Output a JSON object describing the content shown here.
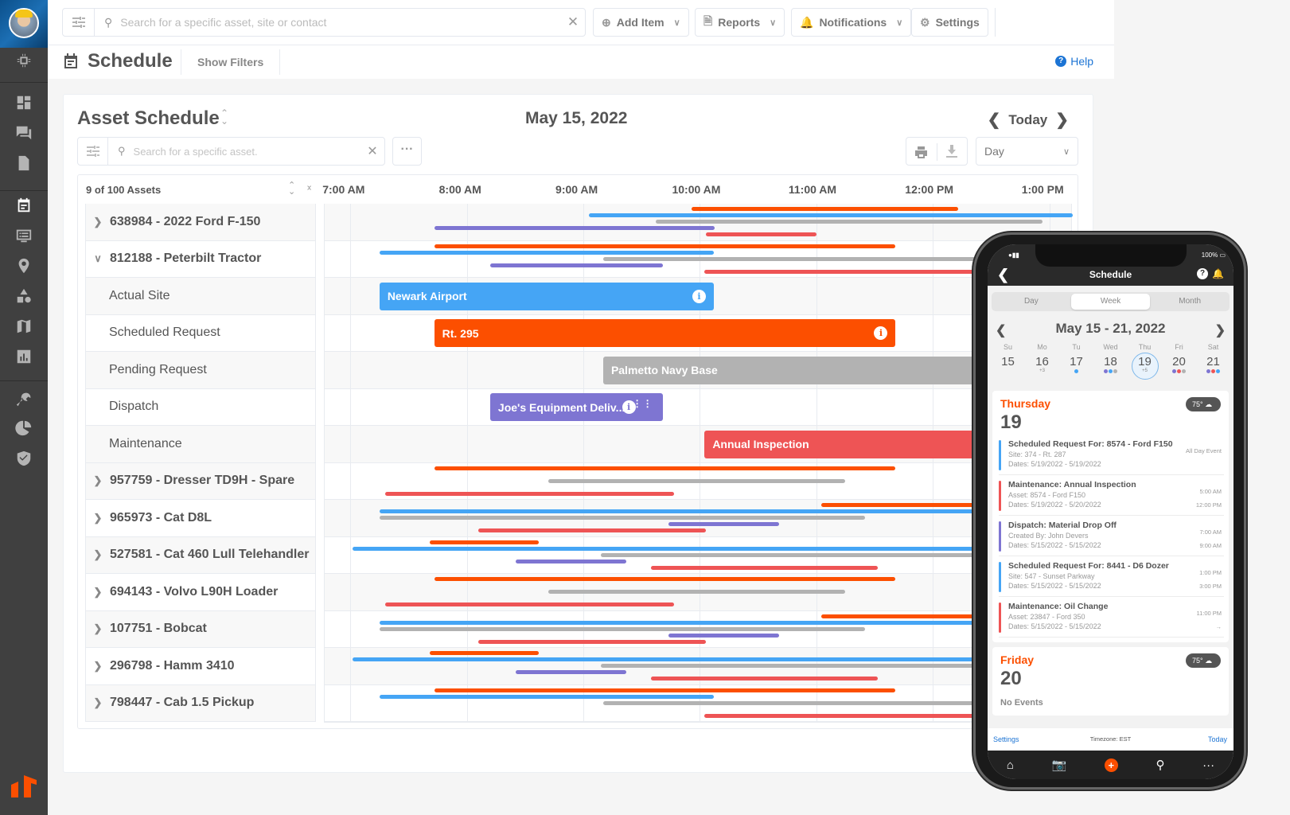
{
  "topbar": {
    "search_placeholder": "Search for a specific asset, site or contact",
    "buttons": [
      {
        "label": "Add Item",
        "icon": "plus-circle-icon"
      },
      {
        "label": "Reports",
        "icon": "document-icon"
      },
      {
        "label": "Notifications",
        "icon": "bell-icon"
      },
      {
        "label": "Settings",
        "icon": "gear-icon"
      }
    ]
  },
  "sidebar": {
    "items": [
      {
        "name": "chip-icon"
      },
      {
        "name": "dashboard-icon"
      },
      {
        "name": "messages-icon"
      },
      {
        "name": "document-icon"
      },
      {
        "name": "calendar-icon",
        "active": true
      },
      {
        "name": "list-monitor-icon"
      },
      {
        "name": "location-pin-icon"
      },
      {
        "name": "shapes-icon"
      },
      {
        "name": "map-icon"
      },
      {
        "name": "bar-chart-icon"
      },
      {
        "name": "wrench-icon"
      },
      {
        "name": "pie-chart-icon"
      },
      {
        "name": "shield-check-icon"
      }
    ],
    "brand_color": "#fc4f00"
  },
  "subbar": {
    "title": "Schedule",
    "show_filters": "Show Filters",
    "help": "Help"
  },
  "schedule": {
    "title": "Asset Schedule",
    "date": "May 15, 2022",
    "today": "Today",
    "search_placeholder": "Search for a specific asset.",
    "view": "Day",
    "asset_count": "9 of 100 Assets",
    "ticks": [
      "7:00 AM",
      "8:00 AM",
      "9:00 AM",
      "10:00 AM",
      "11:00 AM",
      "12:00 PM",
      "1:00 PM"
    ],
    "colors": {
      "site": "#45a5f5",
      "scheduled": "#fc4f00",
      "pending": "#b2b2b2",
      "dispatch": "#7e75d2",
      "maintenance": "#ee5455"
    },
    "rows": [
      {
        "label": "638984 - 2022 Ford F-150",
        "type": "parent",
        "expanded": false
      },
      {
        "label": "812188 - Peterbilt Tractor",
        "type": "parent",
        "expanded": true
      },
      {
        "label": "Actual Site",
        "type": "child"
      },
      {
        "label": "Scheduled Request",
        "type": "child"
      },
      {
        "label": "Pending Request",
        "type": "child"
      },
      {
        "label": "Dispatch",
        "type": "child"
      },
      {
        "label": "Maintenance",
        "type": "child"
      },
      {
        "label": "957759 - Dresser TD9H - Spare",
        "type": "parent",
        "expanded": false
      },
      {
        "label": "965973 - Cat D8L",
        "type": "parent",
        "expanded": false
      },
      {
        "label": "527581 - Cat 460 Lull Telehandler",
        "type": "parent",
        "expanded": false
      },
      {
        "label": "694143 - Volvo L90H Loader",
        "type": "parent",
        "expanded": false
      },
      {
        "label": "107751 - Bobcat",
        "type": "parent",
        "expanded": false
      },
      {
        "label": "296798 - Hamm 3410",
        "type": "parent",
        "expanded": false
      },
      {
        "label": "798447 - Cab 1.5 Pickup",
        "type": "parent",
        "expanded": false
      }
    ],
    "blocks": [
      {
        "row": 2,
        "label": "Newark Airport",
        "type": "site",
        "start": 7.25,
        "end": 10.12,
        "info": true
      },
      {
        "row": 3,
        "label": "Rt. 295",
        "type": "scheduled",
        "start": 7.72,
        "end": 11.68,
        "info": true
      },
      {
        "row": 4,
        "label": "Palmetto Navy Base",
        "type": "pending",
        "start": 9.17,
        "end": 13.0
      },
      {
        "row": 5,
        "label": "Joe's Equipment Deliv...",
        "type": "dispatch",
        "start": 8.2,
        "end": 9.68,
        "info": true,
        "drag": true
      },
      {
        "row": 6,
        "label": "Annual Inspection",
        "type": "maintenance",
        "start": 10.04,
        "end": 13.0
      }
    ],
    "lines": [
      {
        "row": 0,
        "slot": 0,
        "type": "scheduled",
        "start": 9.93,
        "end": 12.22
      },
      {
        "row": 0,
        "slot": 1,
        "type": "site",
        "start": 9.05,
        "end": 13.45
      },
      {
        "row": 0,
        "slot": 2,
        "type": "pending",
        "start": 9.62,
        "end": 12.94
      },
      {
        "row": 0,
        "slot": 3,
        "type": "dispatch",
        "start": 7.72,
        "end": 10.13
      },
      {
        "row": 0,
        "slot": 4,
        "type": "maintenance",
        "start": 10.05,
        "end": 11.0
      },
      {
        "row": 1,
        "slot": 0,
        "type": "scheduled",
        "start": 7.72,
        "end": 11.68
      },
      {
        "row": 1,
        "slot": 1,
        "type": "site",
        "start": 7.25,
        "end": 10.12
      },
      {
        "row": 1,
        "slot": 2,
        "type": "pending",
        "start": 9.17,
        "end": 13.0
      },
      {
        "row": 1,
        "slot": 3,
        "type": "dispatch",
        "start": 8.2,
        "end": 9.68
      },
      {
        "row": 1,
        "slot": 4,
        "type": "maintenance",
        "start": 10.04,
        "end": 13.0
      },
      {
        "row": 7,
        "slot": 0,
        "type": "scheduled",
        "start": 7.72,
        "end": 11.68
      },
      {
        "row": 7,
        "slot": 2,
        "type": "pending",
        "start": 8.7,
        "end": 11.25
      },
      {
        "row": 7,
        "slot": 4,
        "type": "maintenance",
        "start": 7.3,
        "end": 9.78
      },
      {
        "row": 8,
        "slot": 0,
        "type": "scheduled",
        "start": 11.04,
        "end": 13.0
      },
      {
        "row": 8,
        "slot": 1,
        "type": "site",
        "start": 7.25,
        "end": 13.0
      },
      {
        "row": 8,
        "slot": 2,
        "type": "pending",
        "start": 7.25,
        "end": 11.42
      },
      {
        "row": 8,
        "slot": 3,
        "type": "dispatch",
        "start": 9.73,
        "end": 10.68
      },
      {
        "row": 8,
        "slot": 4,
        "type": "maintenance",
        "start": 8.1,
        "end": 10.05
      },
      {
        "row": 9,
        "slot": 0,
        "type": "scheduled",
        "start": 7.68,
        "end": 8.62
      },
      {
        "row": 9,
        "slot": 1,
        "type": "site",
        "start": 7.02,
        "end": 13.0
      },
      {
        "row": 9,
        "slot": 2,
        "type": "pending",
        "start": 9.15,
        "end": 13.0
      },
      {
        "row": 9,
        "slot": 3,
        "type": "dispatch",
        "start": 8.42,
        "end": 9.37
      },
      {
        "row": 9,
        "slot": 4,
        "type": "maintenance",
        "start": 9.58,
        "end": 11.53
      },
      {
        "row": 10,
        "slot": 0,
        "type": "scheduled",
        "start": 7.72,
        "end": 11.68
      },
      {
        "row": 10,
        "slot": 2,
        "type": "pending",
        "start": 8.7,
        "end": 11.25
      },
      {
        "row": 10,
        "slot": 4,
        "type": "maintenance",
        "start": 7.3,
        "end": 9.78
      },
      {
        "row": 11,
        "slot": 0,
        "type": "scheduled",
        "start": 11.04,
        "end": 13.0
      },
      {
        "row": 11,
        "slot": 1,
        "type": "site",
        "start": 7.25,
        "end": 13.0
      },
      {
        "row": 11,
        "slot": 2,
        "type": "pending",
        "start": 7.25,
        "end": 11.42
      },
      {
        "row": 11,
        "slot": 3,
        "type": "dispatch",
        "start": 9.73,
        "end": 10.68
      },
      {
        "row": 11,
        "slot": 4,
        "type": "maintenance",
        "start": 8.1,
        "end": 10.05
      },
      {
        "row": 12,
        "slot": 0,
        "type": "scheduled",
        "start": 7.68,
        "end": 8.62
      },
      {
        "row": 12,
        "slot": 1,
        "type": "site",
        "start": 7.02,
        "end": 13.0
      },
      {
        "row": 12,
        "slot": 2,
        "type": "pending",
        "start": 9.15,
        "end": 13.0
      },
      {
        "row": 12,
        "slot": 3,
        "type": "dispatch",
        "start": 8.42,
        "end": 9.37
      },
      {
        "row": 12,
        "slot": 4,
        "type": "maintenance",
        "start": 9.58,
        "end": 11.53
      },
      {
        "row": 13,
        "slot": 0,
        "type": "scheduled",
        "start": 7.72,
        "end": 11.68
      },
      {
        "row": 13,
        "slot": 1,
        "type": "site",
        "start": 7.25,
        "end": 10.12
      },
      {
        "row": 13,
        "slot": 2,
        "type": "pending",
        "start": 9.17,
        "end": 13.0
      },
      {
        "row": 13,
        "slot": 4,
        "type": "maintenance",
        "start": 10.04,
        "end": 13.0
      }
    ]
  },
  "phone": {
    "battery": "100%",
    "title": "Schedule",
    "segments": [
      "Day",
      "Week",
      "Month"
    ],
    "active_segment": "Week",
    "week_range": "May 15 - 21, 2022",
    "days": [
      {
        "name": "Su",
        "num": "15",
        "sub": "",
        "dots": []
      },
      {
        "name": "Mo",
        "num": "16",
        "sub": "+3",
        "dots": []
      },
      {
        "name": "Tu",
        "num": "17",
        "sub": "",
        "dots": [
          "#45a5f5"
        ]
      },
      {
        "name": "Wed",
        "num": "18",
        "sub": "",
        "dots": [
          "#7e75d2",
          "#45a5f5",
          "#b2b2b2"
        ]
      },
      {
        "name": "Thu",
        "num": "19",
        "sub": "+5",
        "dots": [],
        "selected": true
      },
      {
        "name": "Fri",
        "num": "20",
        "sub": "",
        "dots": [
          "#7e75d2",
          "#ee5455",
          "#b2b2b2"
        ]
      },
      {
        "name": "Sat",
        "num": "21",
        "sub": "",
        "dots": [
          "#7e75d2",
          "#ee5455",
          "#45a5f5"
        ]
      }
    ],
    "thursday": {
      "day_name": "Thursday",
      "day_num": "19",
      "weather": "75°",
      "events": [
        {
          "title": "Scheduled Request For: 8574 - Ford F150",
          "line2": "Site: 374 - Rt. 287",
          "line3": "Dates: 5/19/2022 - 5/19/2022",
          "time1": "All Day Event",
          "time2": "",
          "color": "#45a5f5"
        },
        {
          "title": "Maintenance: Annual Inspection",
          "line2": "Asset: 8574 - Ford F150",
          "line3": "Dates: 5/19/2022 - 5/20/2022",
          "time1": "5:00 AM",
          "time2": "12:00 PM",
          "color": "#ee5455"
        },
        {
          "title": "Dispatch: Material Drop Off",
          "line2": "Created By: John Devers",
          "line3": "Dates: 5/15/2022 - 5/15/2022",
          "time1": "7:00 AM",
          "time2": "9:00 AM",
          "color": "#7e75d2"
        },
        {
          "title": "Scheduled Request For: 8441 - D6 Dozer",
          "line2": "Site: 547 - Sunset Parkway",
          "line3": "Dates: 5/15/2022 - 5/15/2022",
          "time1": "1:00 PM",
          "time2": "3:00 PM",
          "color": "#45a5f5"
        },
        {
          "title": "Maintenance: Oil Change",
          "line2": "Asset: 23847 - Ford 350",
          "line3": "Dates: 5/15/2022 - 5/15/2022",
          "time1": "11:00 PM",
          "time2": "→",
          "color": "#ee5455"
        }
      ]
    },
    "friday": {
      "day_name": "Friday",
      "day_num": "20",
      "weather": "75°",
      "empty": "No Events"
    },
    "footer": {
      "settings": "Settings",
      "timezone": "Timezone: EST",
      "today": "Today"
    }
  }
}
